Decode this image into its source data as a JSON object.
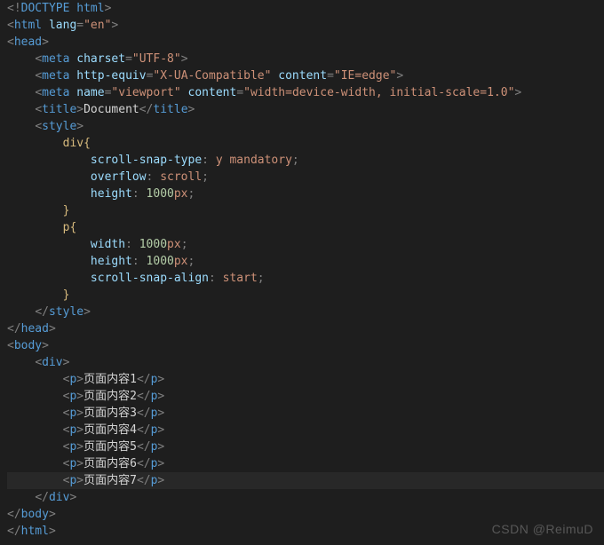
{
  "doctype": "<!DOCTYPE html>",
  "htmlOpen": {
    "tag": "html",
    "attr": "lang",
    "val": "\"en\""
  },
  "headOpen": "head",
  "meta1": {
    "attr1": "charset",
    "val1": "\"UTF-8\""
  },
  "meta2": {
    "attr1": "http-equiv",
    "val1": "\"X-UA-Compatible\"",
    "attr2": "content",
    "val2": "\"IE=edge\""
  },
  "meta3": {
    "attr1": "name",
    "val1": "\"viewport\"",
    "attr2": "content",
    "val2": "\"width=device-width, initial-scale=1.0\""
  },
  "titleTag": "title",
  "titleText": "Document",
  "styleTag": "style",
  "sel1": "div",
  "rule1a": {
    "p": "scroll-snap-type",
    "v": "y mandatory"
  },
  "rule1b": {
    "p": "overflow",
    "v": "scroll"
  },
  "rule1c": {
    "p": "height",
    "n": "1000",
    "u": "px"
  },
  "sel2": "p",
  "rule2a": {
    "p": "width",
    "n": "1000",
    "u": "px"
  },
  "rule2b": {
    "p": "height",
    "n": "1000",
    "u": "px"
  },
  "rule2c": {
    "p": "scroll-snap-align",
    "v": "start"
  },
  "bodyTag": "body",
  "divTag": "div",
  "pTag": "p",
  "p1": "页面内容1",
  "p2": "页面内容2",
  "p3": "页面内容3",
  "p4": "页面内容4",
  "p5": "页面内容5",
  "p6": "页面内容6",
  "p7": "页面内容7",
  "watermark": "CSDN @ReimuD"
}
